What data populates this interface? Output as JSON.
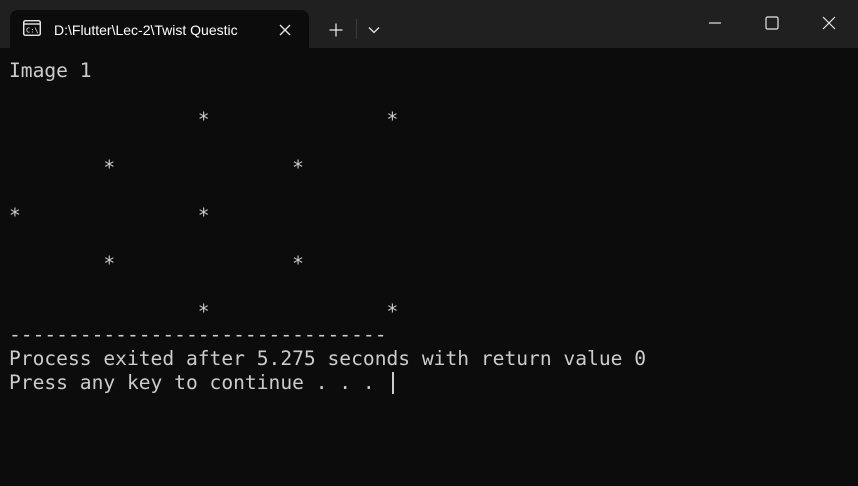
{
  "tab": {
    "icon": "command-prompt-icon",
    "title": "D:\\Flutter\\Lec-2\\Twist Questic"
  },
  "titlebar": {
    "new_tab_icon": "plus-icon",
    "dropdown_icon": "chevron-down-icon",
    "minimize_icon": "minimize-icon",
    "maximize_icon": "maximize-icon",
    "close_icon": "close-icon"
  },
  "console": {
    "heading": "Image 1",
    "pattern": [
      "                *               *",
      "        *               *",
      "*               *",
      "        *               *",
      "                *               *"
    ],
    "separator": "--------------------------------",
    "exit_message": "Process exited after 5.275 seconds with return value 0",
    "prompt": "Press any key to continue . . . "
  },
  "colors": {
    "titlebar_bg": "#202020",
    "console_bg": "#0c0c0c",
    "console_text": "#cccccc"
  }
}
